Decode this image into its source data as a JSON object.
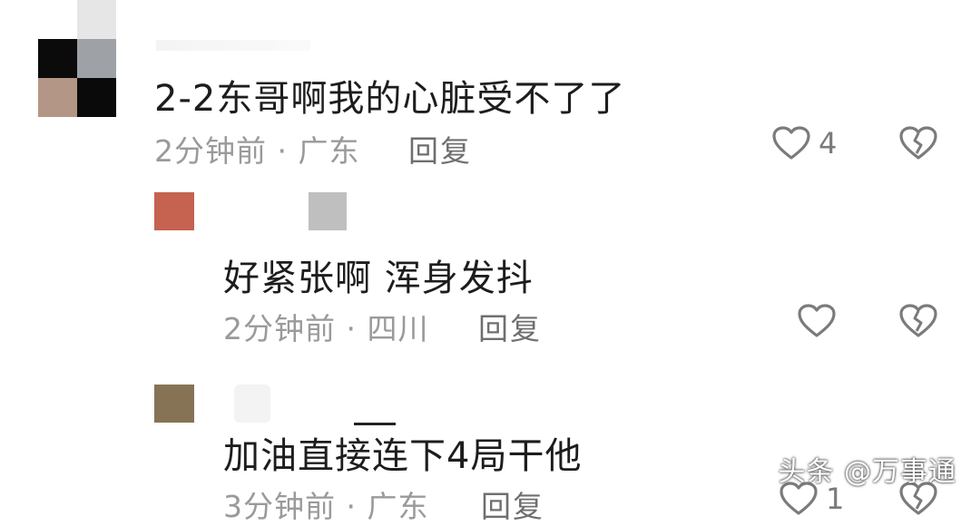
{
  "comments": [
    {
      "text": "2-2东哥啊我的心脏受不了了",
      "meta": "2分钟前 · 广东",
      "reply_label": "回复",
      "like_count": "4",
      "avatar_colors": [
        "#eaeaea",
        "#ffffff",
        "#0b0b0b",
        "#9ea2a6",
        "#b39685",
        "#0a0a0a"
      ]
    },
    {
      "text": "好紧张啊  浑身发抖",
      "meta": "2分钟前 · 四川",
      "reply_label": "回复",
      "like_count": "",
      "avatar_color": "#c56250"
    },
    {
      "text": "加油直接连下4局干他",
      "meta": "3分钟前 · 广东",
      "reply_label": "回复",
      "like_count": "1",
      "avatar_color": "#867356"
    }
  ],
  "watermark": "头条 @万事通",
  "icons": {
    "like": "heart-outline-icon",
    "dislike": "broken-heart-icon"
  },
  "colors": {
    "text": "#1d1d1d",
    "meta": "#9a9a9a",
    "icon": "#7b7b7b"
  }
}
